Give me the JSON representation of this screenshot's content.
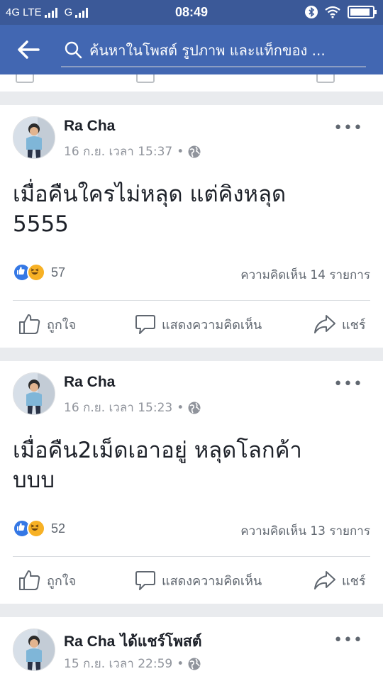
{
  "status_bar": {
    "network_left": "4G LTE",
    "network_right": "G",
    "time": "08:49"
  },
  "search": {
    "placeholder": "ค้นหาในโพสต์ รูปภาพ และแท็กของ ..."
  },
  "posts": [
    {
      "author": "Ra Cha",
      "suffix": "",
      "timestamp": "16 ก.ย. เวลา 15:37",
      "separator": "•",
      "text_line1": "เมื่อคืนใครไม่หลุด แต่คิงหลุด",
      "text_line2": "5555",
      "reaction_count": "57",
      "comment_count": "ความคิดเห็น 14 รายการ"
    },
    {
      "author": "Ra Cha",
      "suffix": "",
      "timestamp": "16 ก.ย. เวลา 15:23",
      "separator": "•",
      "text_line1": "เมื่อคืน2เม็ดเอาอยู่ หลุดโลกค้า",
      "text_line2": "บบบ",
      "reaction_count": "52",
      "comment_count": "ความคิดเห็น 13 รายการ"
    },
    {
      "author": "Ra Cha",
      "suffix": " ได้แชร์โพสต์",
      "timestamp": "15 ก.ย. เวลา 22:59",
      "separator": "•"
    }
  ],
  "actions": {
    "like": "ถูกใจ",
    "comment": "แสดงความคิดเห็น",
    "share": "แชร์"
  },
  "icons": {
    "back": "back-arrow-icon",
    "search": "search-icon",
    "globe": "globe-icon",
    "more": "more-options-icon",
    "like_reaction": "like-reaction-icon",
    "haha_reaction": "haha-reaction-icon",
    "like_action": "thumbs-up-icon",
    "comment_action": "comment-bubble-icon",
    "share_action": "share-arrow-icon"
  },
  "colors": {
    "status_bar": "#3b5998",
    "nav_bar": "#4267b2",
    "like_blue": "#3578e5",
    "haha_yellow": "#f7b125",
    "feed_background": "#e9ebee"
  },
  "battery_level": 0.9
}
